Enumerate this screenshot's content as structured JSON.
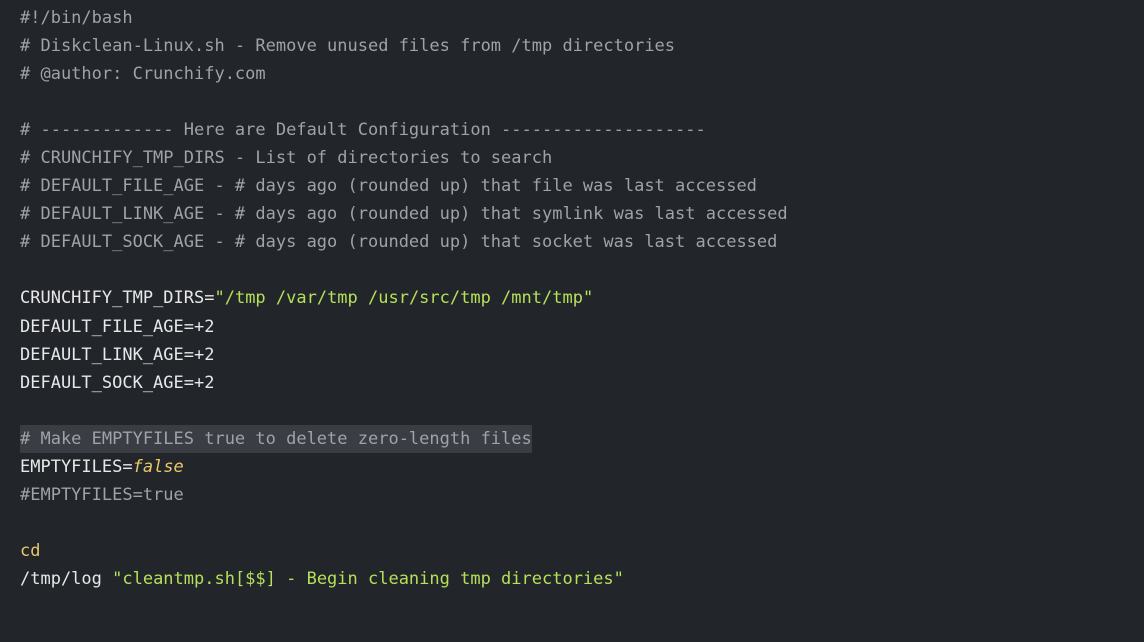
{
  "lines": [
    {
      "segments": [
        {
          "cls": "comment",
          "text": "#!/bin/bash"
        }
      ]
    },
    {
      "segments": [
        {
          "cls": "comment",
          "text": "# Diskclean-Linux.sh - Remove unused files from /tmp directories"
        }
      ]
    },
    {
      "segments": [
        {
          "cls": "comment",
          "text": "# @author: Crunchify.com"
        }
      ]
    },
    {
      "segments": [
        {
          "cls": "",
          "text": ""
        }
      ]
    },
    {
      "segments": [
        {
          "cls": "comment",
          "text": "# ------------- Here are Default Configuration --------------------"
        }
      ]
    },
    {
      "segments": [
        {
          "cls": "comment",
          "text": "# CRUNCHIFY_TMP_DIRS - List of directories to search"
        }
      ]
    },
    {
      "segments": [
        {
          "cls": "comment",
          "text": "# DEFAULT_FILE_AGE - # days ago (rounded up) that file was last accessed"
        }
      ]
    },
    {
      "segments": [
        {
          "cls": "comment",
          "text": "# DEFAULT_LINK_AGE - # days ago (rounded up) that symlink was last accessed"
        }
      ]
    },
    {
      "segments": [
        {
          "cls": "comment",
          "text": "# DEFAULT_SOCK_AGE - # days ago (rounded up) that socket was last accessed"
        }
      ]
    },
    {
      "segments": [
        {
          "cls": "",
          "text": ""
        }
      ]
    },
    {
      "segments": [
        {
          "cls": "var",
          "text": "CRUNCHIFY_TMP_DIRS"
        },
        {
          "cls": "equals",
          "text": "="
        },
        {
          "cls": "string",
          "text": "\"/tmp /var/tmp /usr/src/tmp /mnt/tmp\""
        }
      ]
    },
    {
      "segments": [
        {
          "cls": "var",
          "text": "DEFAULT_FILE_AGE"
        },
        {
          "cls": "equals",
          "text": "=+2"
        }
      ]
    },
    {
      "segments": [
        {
          "cls": "var",
          "text": "DEFAULT_LINK_AGE"
        },
        {
          "cls": "equals",
          "text": "=+2"
        }
      ]
    },
    {
      "segments": [
        {
          "cls": "var",
          "text": "DEFAULT_SOCK_AGE"
        },
        {
          "cls": "equals",
          "text": "=+2"
        }
      ]
    },
    {
      "segments": [
        {
          "cls": "",
          "text": ""
        }
      ]
    },
    {
      "highlight": true,
      "segments": [
        {
          "cls": "comment",
          "text": "# Make EMPTYFILES true to delete zero-length files"
        }
      ]
    },
    {
      "segments": [
        {
          "cls": "var",
          "text": "EMPTYFILES"
        },
        {
          "cls": "equals",
          "text": "="
        },
        {
          "cls": "keyword",
          "text": "false"
        }
      ]
    },
    {
      "segments": [
        {
          "cls": "comment",
          "text": "#EMPTYFILES=true"
        }
      ]
    },
    {
      "segments": [
        {
          "cls": "",
          "text": ""
        }
      ]
    },
    {
      "segments": [
        {
          "cls": "builtin",
          "text": "cd"
        }
      ]
    },
    {
      "segments": [
        {
          "cls": "var",
          "text": "/tmp/log "
        },
        {
          "cls": "string",
          "text": "\"cleantmp.sh[$$] - Begin cleaning tmp directories\""
        }
      ]
    }
  ]
}
